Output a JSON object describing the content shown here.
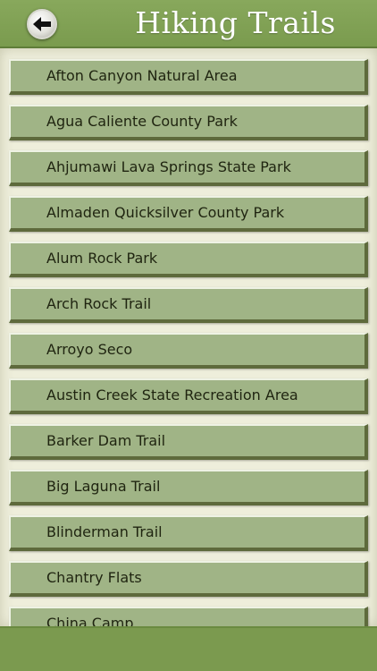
{
  "header": {
    "title": "Hiking Trails",
    "back_icon": "back-arrow-icon"
  },
  "colors": {
    "header": "#7f9f55",
    "item_background": "#a0b486",
    "page_background": "#eeeedb",
    "footer": "#7b9a4f"
  },
  "trails": [
    "Afton Canyon Natural Area",
    "Agua Caliente County Park",
    "Ahjumawi Lava Springs State Park",
    "Almaden Quicksilver County Park",
    "Alum Rock Park",
    "Arch Rock Trail",
    "Arroyo Seco",
    "Austin Creek State Recreation Area",
    "Barker Dam Trail",
    "Big Laguna Trail",
    "Blinderman Trail",
    "Chantry Flats",
    "China Camp"
  ]
}
